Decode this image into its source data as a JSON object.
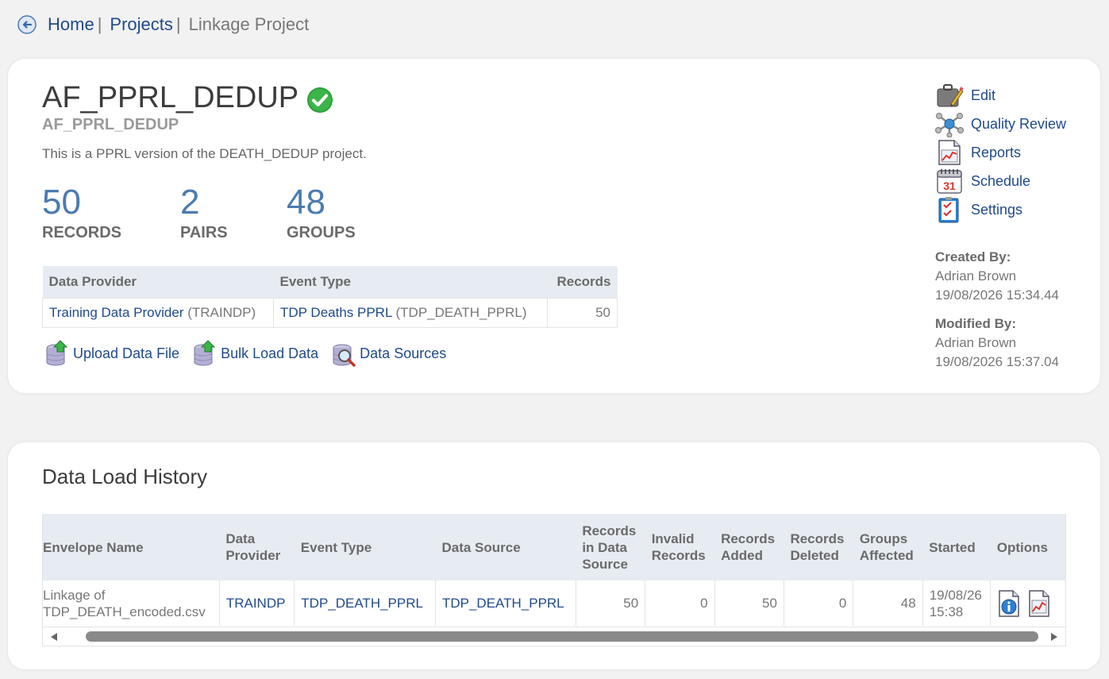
{
  "breadcrumb": {
    "home": "Home",
    "projects": "Projects",
    "current": "Linkage Project",
    "separator": "|"
  },
  "project": {
    "title": "AF_PPRL_DEDUP",
    "code": "AF_PPRL_DEDUP",
    "description": "This is a PPRL version of the DEATH_DEDUP project.",
    "stats": [
      {
        "value": "50",
        "label": "RECORDS"
      },
      {
        "value": "2",
        "label": "PAIRS"
      },
      {
        "value": "48",
        "label": "GROUPS"
      }
    ],
    "status_icon": "check-circle-icon",
    "accent_color": "#4a7bb0"
  },
  "providers_table": {
    "headers": [
      "Data Provider",
      "Event Type",
      "Records"
    ],
    "rows": [
      {
        "provider_link": "Training Data Provider",
        "provider_code": "(TRAINDP)",
        "event_link": "TDP Deaths PPRL",
        "event_code": "(TDP_DEATH_PPRL)",
        "records": "50"
      }
    ]
  },
  "actions": {
    "upload": "Upload Data File",
    "bulk": "Bulk Load Data",
    "sources": "Data Sources"
  },
  "side_menu": {
    "edit": "Edit",
    "quality": "Quality Review",
    "reports": "Reports",
    "schedule": "Schedule",
    "settings": "Settings"
  },
  "meta": {
    "created_label": "Created By:",
    "created_by": "Adrian Brown",
    "created_at": "19/08/2026 15:34.44",
    "modified_label": "Modified By:",
    "modified_by": "Adrian Brown",
    "modified_at": "19/08/2026 15:37.04"
  },
  "history": {
    "title": "Data Load History",
    "headers": {
      "envelope": "Envelope Name",
      "provider_1": "Data",
      "provider_2": "Provider",
      "event": "Event Type",
      "source": "Data Source",
      "rids_1": "Records",
      "rids_2": "in Data",
      "rids_3": "Source",
      "invalid_1": "Invalid",
      "invalid_2": "Records",
      "added_1": "Records",
      "added_2": "Added",
      "deleted_1": "Records",
      "deleted_2": "Deleted",
      "groups_1": "Groups",
      "groups_2": "Affected",
      "started": "Started",
      "options": "Options"
    },
    "rows": [
      {
        "envelope_1": "Linkage of",
        "envelope_2": "TDP_DEATH_encoded.csv",
        "provider": "TRAINDP",
        "event": "TDP_DEATH_PPRL",
        "source": "TDP_DEATH_PPRL",
        "in_source": "50",
        "invalid": "0",
        "added": "50",
        "deleted": "0",
        "groups": "48",
        "started_1": "19/08/26",
        "started_2": "15:38"
      }
    ]
  }
}
